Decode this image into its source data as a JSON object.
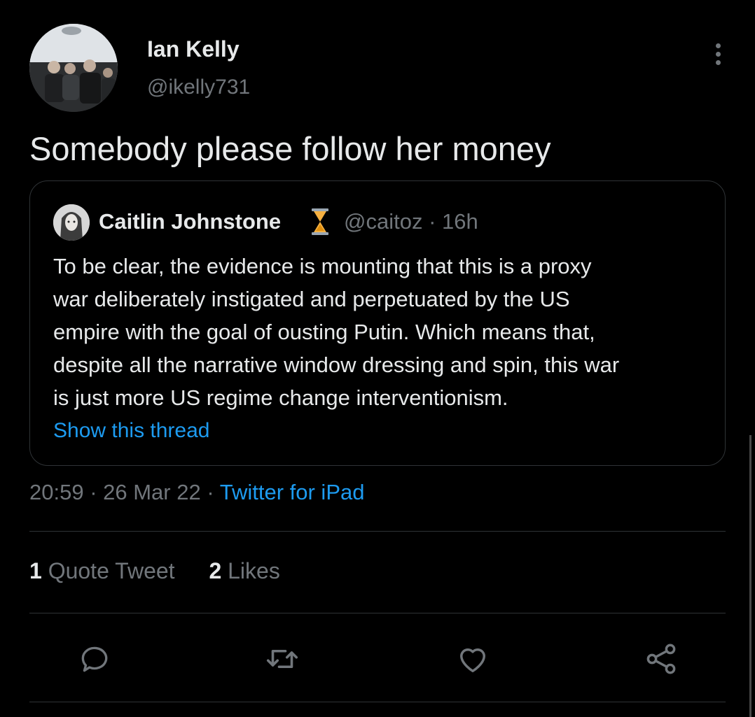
{
  "author": {
    "name": "Ian Kelly",
    "handle": "@ikelly731"
  },
  "tweet": {
    "text": "Somebody please follow her money"
  },
  "quoted": {
    "name": "Caitlin Johnstone",
    "handle_time": "@caitoz · 16h",
    "lines": [
      "To be clear, the evidence is mounting that this is a proxy",
      "war deliberately instigated and perpetuated by the US",
      "empire with the goal of ousting Putin. Which means that,",
      "despite all the narrative window dressing and spin, this war",
      "is just more US regime change interventionism."
    ],
    "show_thread": "Show this thread"
  },
  "meta": {
    "time": "20:59",
    "date": "26 Mar 22",
    "source": "Twitter for iPad"
  },
  "stats": {
    "quote_count": "1",
    "quote_label": "Quote Tweet",
    "likes_count": "2",
    "likes_label": "Likes"
  },
  "colors": {
    "background": "#000000",
    "text": "#e7e9ea",
    "muted": "#71767b",
    "link": "#1d9bf0",
    "border": "#2f3336"
  }
}
